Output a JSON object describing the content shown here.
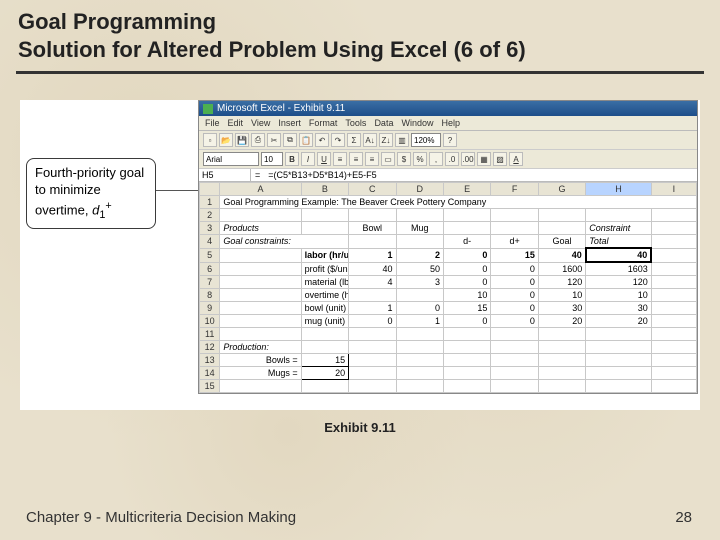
{
  "slide": {
    "title_line1": "Goal Programming",
    "title_line2": "Solution for Altered Problem Using Excel (6 of 6)",
    "exhibit_label": "Exhibit 9.11",
    "footer_left": "Chapter 9 - Multicriteria Decision Making",
    "footer_right": "28"
  },
  "callout": {
    "text_prefix": "Fourth-priority goal to minimize overtime, ",
    "var": "d",
    "sub": "1",
    "sup": "+"
  },
  "excel": {
    "window_title": "Microsoft Excel - Exhibit 9.11",
    "menu": [
      "File",
      "Edit",
      "View",
      "Insert",
      "Format",
      "Tools",
      "Data",
      "Window",
      "Help"
    ],
    "font_name": "Arial",
    "font_size": "10",
    "zoom": "120%",
    "name_box": "H5",
    "formula": "=(C5*B13+D5*B14)+E5-F5",
    "columns": [
      "A",
      "B",
      "C",
      "D",
      "E",
      "F",
      "G",
      "H",
      "I"
    ],
    "row_nums": [
      "1",
      "2",
      "3",
      "4",
      "5",
      "6",
      "7",
      "8",
      "9",
      "10",
      "11",
      "12",
      "13",
      "14",
      "15"
    ],
    "r1_A": "Goal Programming Example: The Beaver Creek Pottery Company",
    "r3": {
      "A": "Products",
      "C": "Bowl",
      "D": "Mug",
      "H": "Constraint"
    },
    "r4": {
      "A": "Goal constraints:",
      "E": "d-",
      "F": "d+",
      "G": "Goal",
      "H": "Total"
    },
    "r5": {
      "B": "labor (hr/unit)",
      "C": "1",
      "D": "2",
      "E": "0",
      "F": "15",
      "G": "40",
      "H": "40"
    },
    "r6": {
      "B": "profit ($/unit)",
      "C": "40",
      "D": "50",
      "E": "0",
      "F": "0",
      "G": "1600",
      "H": "1603"
    },
    "r7": {
      "B": "material (lbs/unit)",
      "C": "4",
      "D": "3",
      "E": "0",
      "F": "0",
      "G": "120",
      "H": "120"
    },
    "r8": {
      "B": "overtime (hr)",
      "E": "10",
      "F": "0",
      "G": "10",
      "H": "10"
    },
    "r9": {
      "B": "bowl (unit)",
      "C": "1",
      "D": "0",
      "E": "15",
      "F": "0",
      "G": "30",
      "H": "30"
    },
    "r10": {
      "B": "mug (unit)",
      "C": "0",
      "D": "1",
      "E": "0",
      "F": "0",
      "G": "20",
      "H": "20"
    },
    "r12": {
      "A": "Production:"
    },
    "r13": {
      "A": "Bowls =",
      "B": "15"
    },
    "r14": {
      "A": "Mugs =",
      "B": "20"
    }
  }
}
